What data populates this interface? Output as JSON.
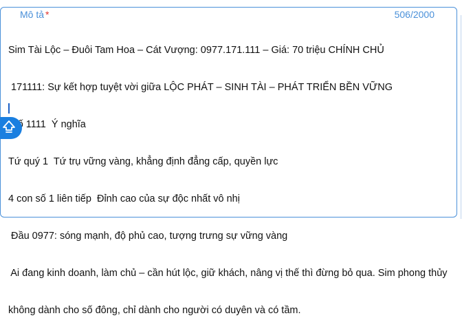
{
  "field": {
    "label": "Mô tả",
    "required_mark": "*",
    "counter": "506/2000",
    "lines": [
      "Sim Tài Lộc – Đuôi Tam Hoa – Cát Vượng: 0977.171.111 – Giá: 70 triệu CHÍNH CHỦ",
      " 171111: Sự kết hợp tuyệt vời giữa LỘC PHÁT – SINH TÀI – PHÁT TRIỂN BỀN VỮNG",
      " Số 1111  Ý nghĩa",
      "Tứ quý 1  Tứ trụ vững vàng, khẳng định đẳng cấp, quyền lực",
      "4 con số 1 liên tiếp  Đỉnh cao của sự độc nhất vô nhị",
      " Đầu 0977: sóng mạnh, độ phủ cao, tượng trưng sự vững vàng",
      " Ai đang kinh doanh, làm chủ – cần hút lộc, giữ khách, nâng vị thế thì đừng bỏ qua. Sim phong thủy",
      "không dành cho số đông, chỉ dành cho người có duyên và có tầm."
    ]
  },
  "fab_icon": "scroll-to-top-icon",
  "colors": {
    "accent": "#4a90d9",
    "required": "#e0312b",
    "fab": "#1a7fe0"
  }
}
